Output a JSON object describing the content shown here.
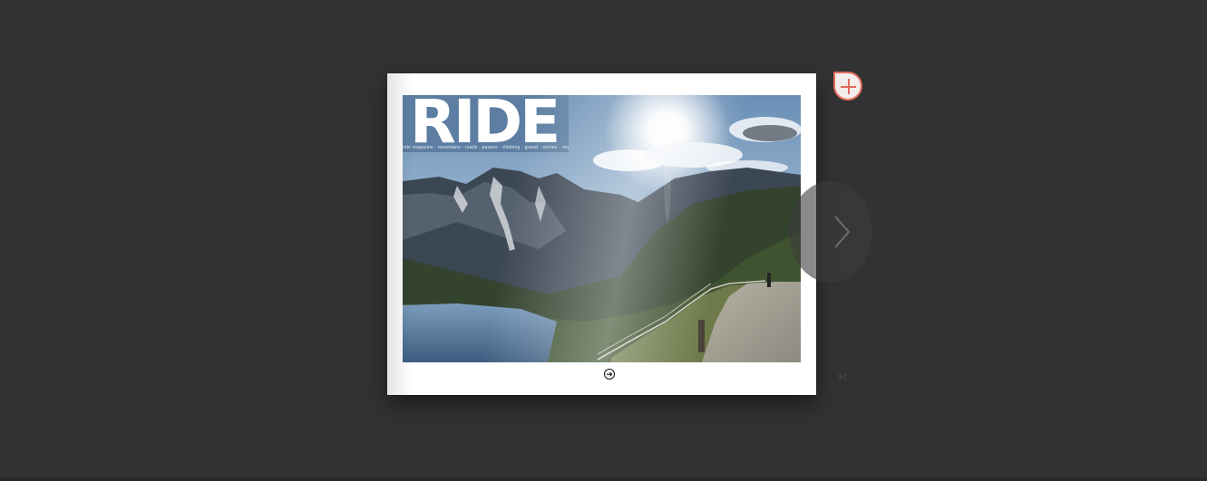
{
  "magazine": {
    "masthead": "RIDE",
    "tagline": "ride magazine · mountains · roads · passes · climbing · gravel · stories · routes · alpine"
  },
  "controls": {
    "next_page_arrow": "➔",
    "bookmark_add_icon": "plus-icon",
    "next_icon": "chevron-right-icon",
    "last_page_icon": "skip-to-end-icon"
  },
  "colors": {
    "background": "#333333",
    "accent": "#e06a5c"
  }
}
